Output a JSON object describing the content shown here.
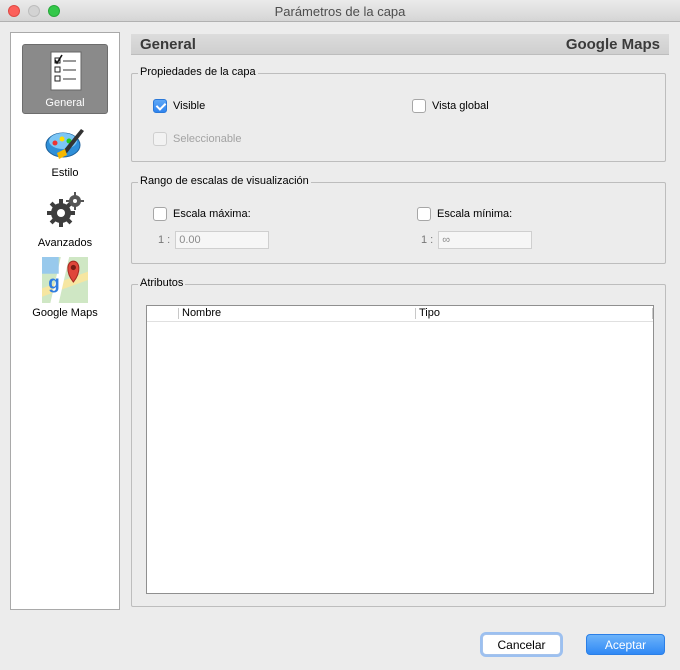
{
  "window": {
    "title": "Parámetros de la capa"
  },
  "sidebar": {
    "items": [
      {
        "label": "General",
        "icon": "checklist-icon",
        "active": true
      },
      {
        "label": "Estilo",
        "icon": "palette-brush-icon",
        "active": false
      },
      {
        "label": "Avanzados",
        "icon": "gears-icon",
        "active": false
      },
      {
        "label": "Google Maps",
        "icon": "google-maps-icon",
        "active": false
      }
    ]
  },
  "header": {
    "left": "General",
    "right": "Google Maps"
  },
  "layer_properties": {
    "title": "Propiedades de la capa",
    "visible": {
      "label": "Visible",
      "checked": true
    },
    "global_view": {
      "label": "Vista global",
      "checked": false
    },
    "selectable": {
      "label": "Seleccionable",
      "checked": false,
      "disabled": true
    }
  },
  "scale_range": {
    "title": "Rango de escalas de visualización",
    "max": {
      "label": "Escala máxima:",
      "prefix": "1 :",
      "value": "0.00"
    },
    "min": {
      "label": "Escala mínima:",
      "prefix": "1 :",
      "value": "∞"
    }
  },
  "attributes": {
    "title": "Atributos",
    "columns": [
      "",
      "Nombre",
      "Tipo"
    ]
  },
  "buttons": {
    "cancel": "Cancelar",
    "ok": "Aceptar"
  },
  "colors": {
    "accent": "#3089f5",
    "active_sidebar": "#8a8a8a"
  }
}
